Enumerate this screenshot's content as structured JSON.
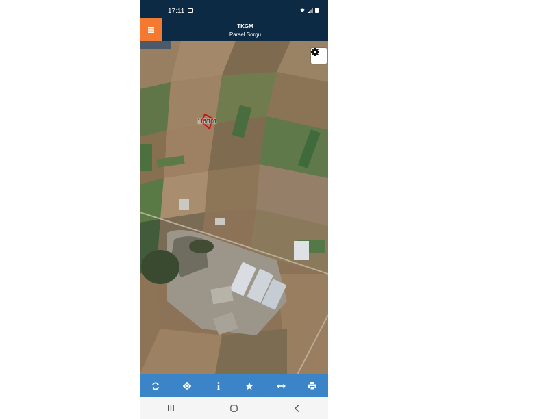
{
  "status": {
    "time": "17:11",
    "icons": [
      "image-icon",
      "wifi-icon",
      "signal-icon",
      "battery-icon"
    ]
  },
  "header": {
    "title": "TKGM",
    "subtitle": "Parsel Sorgu",
    "menu_icon": "menu-icon",
    "accent": "#f47a32",
    "background": "#0d2a45"
  },
  "map": {
    "parcel_label": "116/101",
    "parcel_color": "#c0151d",
    "settings_icon": "gear-icon"
  },
  "toolbar": {
    "background": "#3c84c8",
    "buttons": [
      {
        "name": "refresh",
        "icon": "refresh-icon"
      },
      {
        "name": "locate",
        "icon": "crosshair-icon"
      },
      {
        "name": "info",
        "icon": "info-icon"
      },
      {
        "name": "favorite",
        "icon": "star-icon"
      },
      {
        "name": "measure",
        "icon": "measure-icon"
      },
      {
        "name": "print",
        "icon": "print-icon"
      }
    ]
  },
  "navbar": {
    "buttons": [
      "recents-icon",
      "home-icon",
      "back-icon"
    ]
  }
}
